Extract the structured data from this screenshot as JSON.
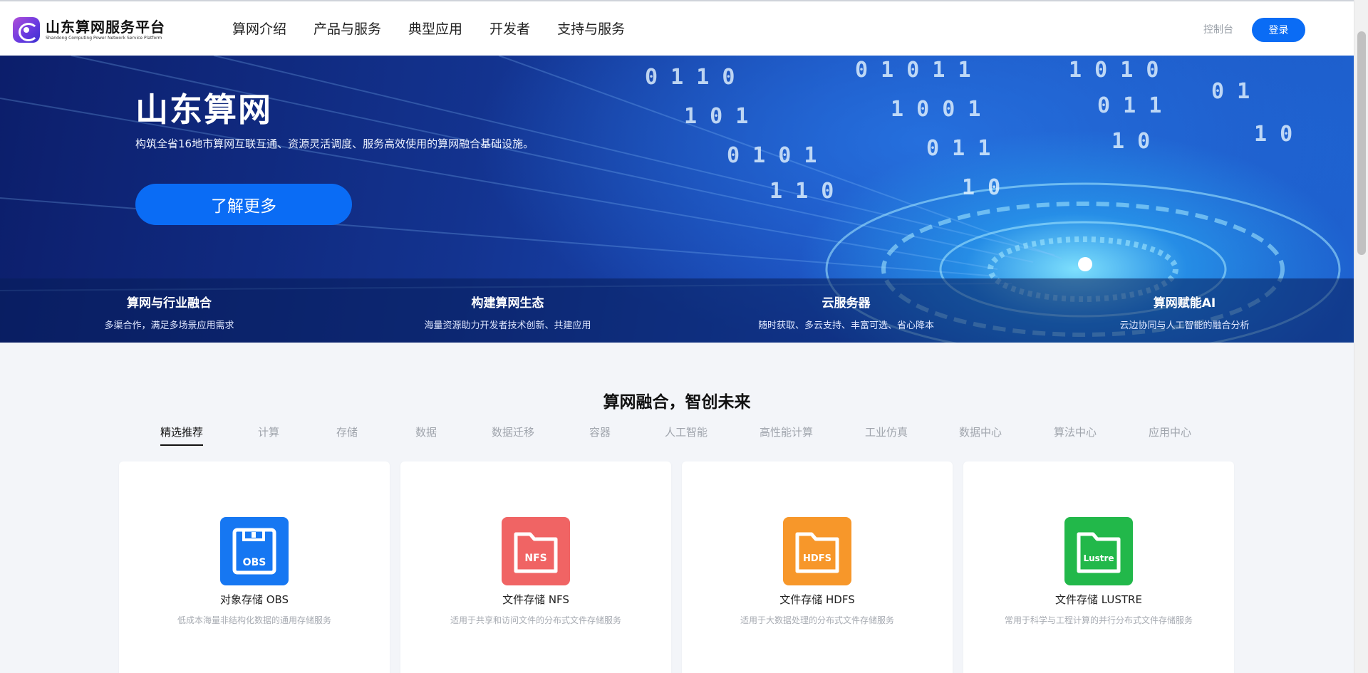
{
  "header": {
    "logo_title": "山东算网服务平台",
    "logo_subtitle": "Shandong Computing Power Network Service Platform",
    "nav": [
      "算网介绍",
      "产品与服务",
      "典型应用",
      "开发者",
      "支持与服务"
    ],
    "console_label": "控制台",
    "login_label": "登录"
  },
  "hero": {
    "title": "山东算网",
    "description": "构筑全省16地市算网互联互通、资源灵活调度、服务高效使用的算网融合基础设施。",
    "button_label": "了解更多",
    "features": [
      {
        "title": "算网与行业融合",
        "desc": "多渠合作，满足多场景应用需求"
      },
      {
        "title": "构建算网生态",
        "desc": "海量资源助力开发者技术创新、共建应用"
      },
      {
        "title": "云服务器",
        "desc": "随时获取、多云支持、丰富可选、省心降本"
      },
      {
        "title": "算网赋能AI",
        "desc": "云边协同与人工智能的融合分析"
      }
    ]
  },
  "section": {
    "title": "算网融合，智创未来",
    "tabs": [
      "精选推荐",
      "计算",
      "存储",
      "数据",
      "数据迁移",
      "容器",
      "人工智能",
      "高性能计算",
      "工业仿真",
      "数据中心",
      "算法中心",
      "应用中心"
    ],
    "active_tab": "精选推荐"
  },
  "cards": [
    {
      "icon_label": "OBS",
      "icon": "floppy-disk-icon",
      "color": "#1677f2",
      "title": "对象存储 OBS",
      "desc": "低成本海量非结构化数据的通用存储服务"
    },
    {
      "icon_label": "NFS",
      "icon": "folder-icon",
      "color": "#f06464",
      "title": "文件存储 NFS",
      "desc": "适用于共享和访问文件的分布式文件存储服务"
    },
    {
      "icon_label": "HDFS",
      "icon": "folder-icon",
      "color": "#f7972a",
      "title": "文件存储 HDFS",
      "desc": "适用于大数据处理的分布式文件存储服务"
    },
    {
      "icon_label": "Lustre",
      "icon": "folder-icon",
      "color": "#22b84a",
      "title": "文件存储 LUSTRE",
      "desc": "常用于科学与工程计算的并行分布式文件存储服务"
    }
  ],
  "colors": {
    "accent": "#0a6cf5",
    "hero_dark": "#0c1e6b",
    "page_bg": "#f3f5f9"
  }
}
